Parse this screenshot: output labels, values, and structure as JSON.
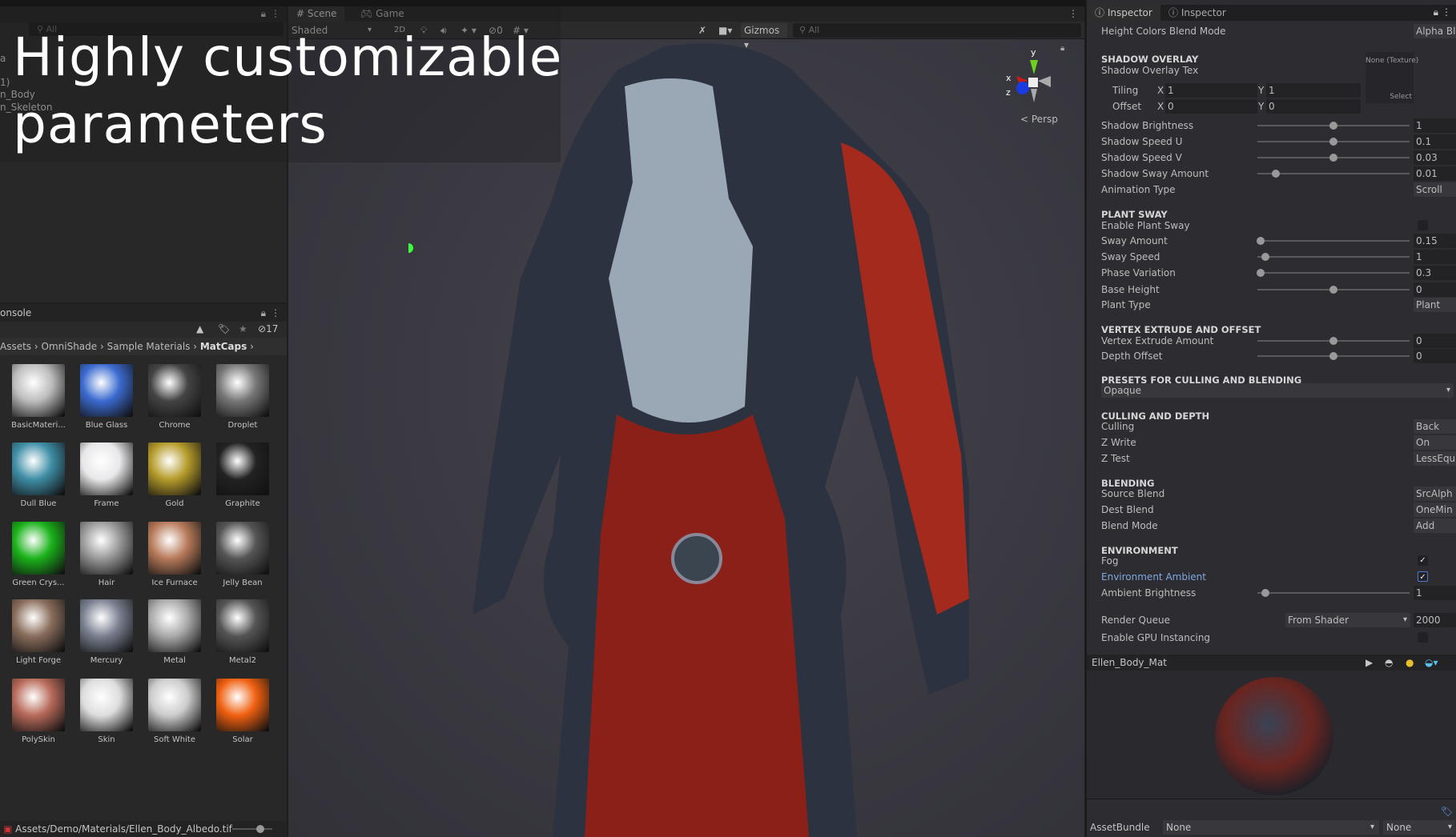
{
  "overlay_title": [
    "Highly customizable",
    "parameters"
  ],
  "hierarchy": {
    "search_placeholder": "All",
    "items": [
      "a",
      "1)",
      "n_Body",
      "n_Skeleton"
    ]
  },
  "scene": {
    "tabs": [
      "Scene",
      "Game"
    ],
    "shading": "Shaded",
    "mode_2d": "2D",
    "hidden_count": "0",
    "gizmos": "Gizmos",
    "search_placeholder": "All",
    "persp": "Persp",
    "axes": [
      "x",
      "y",
      "z"
    ]
  },
  "project": {
    "title": "onsole",
    "hidden_count": "17",
    "breadcrumb": [
      "Assets",
      "OmniShade",
      "Sample Materials",
      "MatCaps"
    ],
    "items": [
      {
        "name": "BasicMateri...",
        "color": "#bdbdbd"
      },
      {
        "name": "Blue Glass",
        "color": "#3b6bd0"
      },
      {
        "name": "Chrome",
        "color": "#444"
      },
      {
        "name": "Droplet",
        "color": "#777"
      },
      {
        "name": "Dull Blue",
        "color": "#3e8ea6"
      },
      {
        "name": "Frame",
        "color": "#e8e8ea"
      },
      {
        "name": "Gold",
        "color": "#b59b2a"
      },
      {
        "name": "Graphite",
        "color": "#222"
      },
      {
        "name": "Green Crys...",
        "color": "#1ab21a"
      },
      {
        "name": "Hair",
        "color": "#999"
      },
      {
        "name": "Ice Furnace",
        "color": "#b87a5a"
      },
      {
        "name": "Jelly Bean",
        "color": "#555"
      },
      {
        "name": "Light Forge",
        "color": "#8a6d5c"
      },
      {
        "name": "Mercury",
        "color": "#7a8090"
      },
      {
        "name": "Metal",
        "color": "#aaa"
      },
      {
        "name": "Metal2",
        "color": "#555"
      },
      {
        "name": "PolySkin",
        "color": "#b86a5a"
      },
      {
        "name": "Skin",
        "color": "#ddd"
      },
      {
        "name": "Soft White",
        "color": "#ccc"
      },
      {
        "name": "Solar",
        "color": "#f06010"
      }
    ],
    "status_path": "Assets/Demo/Materials/Ellen_Body_Albedo.tif"
  },
  "inspector": {
    "tabs": [
      "Inspector",
      "Inspector"
    ],
    "rows": [
      {
        "t": "dd",
        "label": "Height Colors Blend Mode",
        "value": "Alpha Bl"
      },
      {
        "t": "sec",
        "label": "SHADOW OVERLAY"
      },
      {
        "t": "tex",
        "label": "Shadow Overlay Tex",
        "value": "None (Texture)",
        "button": "Select"
      },
      {
        "t": "xy",
        "label": "Tiling",
        "x": "1",
        "y": "1"
      },
      {
        "t": "xy",
        "label": "Offset",
        "x": "0",
        "y": "0"
      },
      {
        "t": "sl",
        "label": "Shadow Brightness",
        "value": "1",
        "frac": 0.5
      },
      {
        "t": "sl",
        "label": "Shadow Speed U",
        "value": "0.1",
        "frac": 0.5
      },
      {
        "t": "sl",
        "label": "Shadow Speed V",
        "value": "0.03",
        "frac": 0.5
      },
      {
        "t": "sl",
        "label": "Shadow Sway Amount",
        "value": "0.01",
        "frac": 0.12
      },
      {
        "t": "dd",
        "label": "Animation Type",
        "value": "Scroll"
      },
      {
        "t": "sec",
        "label": "PLANT SWAY"
      },
      {
        "t": "chk",
        "label": "Enable Plant Sway",
        "checked": false
      },
      {
        "t": "sl",
        "label": "Sway Amount",
        "value": "0.15",
        "frac": 0.02
      },
      {
        "t": "sl",
        "label": "Sway Speed",
        "value": "1",
        "frac": 0.05
      },
      {
        "t": "sl",
        "label": "Phase Variation",
        "value": "0.3",
        "frac": 0.02
      },
      {
        "t": "sl",
        "label": "Base Height",
        "value": "0",
        "frac": 0.5
      },
      {
        "t": "dd",
        "label": "Plant Type",
        "value": "Plant"
      },
      {
        "t": "sec",
        "label": "VERTEX EXTRUDE AND OFFSET"
      },
      {
        "t": "sl",
        "label": "Vertex Extrude Amount",
        "value": "0",
        "frac": 0.5
      },
      {
        "t": "sl",
        "label": "Depth Offset",
        "value": "0",
        "frac": 0.5
      },
      {
        "t": "sec",
        "label": "PRESETS FOR CULLING AND BLENDING"
      },
      {
        "t": "wide",
        "label": "Opaque"
      },
      {
        "t": "sec",
        "label": "CULLING AND DEPTH"
      },
      {
        "t": "dd",
        "label": "Culling",
        "value": "Back"
      },
      {
        "t": "dd",
        "label": "Z Write",
        "value": "On"
      },
      {
        "t": "dd",
        "label": "Z Test",
        "value": "LessEqu"
      },
      {
        "t": "sec",
        "label": "BLENDING"
      },
      {
        "t": "dd",
        "label": "Source Blend",
        "value": "SrcAlph"
      },
      {
        "t": "dd",
        "label": "Dest Blend",
        "value": "OneMin"
      },
      {
        "t": "dd",
        "label": "Blend Mode",
        "value": "Add"
      },
      {
        "t": "sec",
        "label": "ENVIRONMENT"
      },
      {
        "t": "chk",
        "label": "Fog",
        "checked": true
      },
      {
        "t": "chk",
        "label": "Environment Ambient",
        "checked": true,
        "focus": true
      },
      {
        "t": "sl",
        "label": "Ambient Brightness",
        "value": "1",
        "frac": 0.05
      },
      {
        "t": "rq",
        "label": "Render Queue",
        "option": "From Shader",
        "value": "2000"
      },
      {
        "t": "chk",
        "label": "Enable GPU Instancing",
        "checked": false
      }
    ],
    "preview_title": "Ellen_Body_Mat",
    "assetbundle": {
      "label": "AssetBundle",
      "name": "None",
      "variant": "None"
    }
  }
}
